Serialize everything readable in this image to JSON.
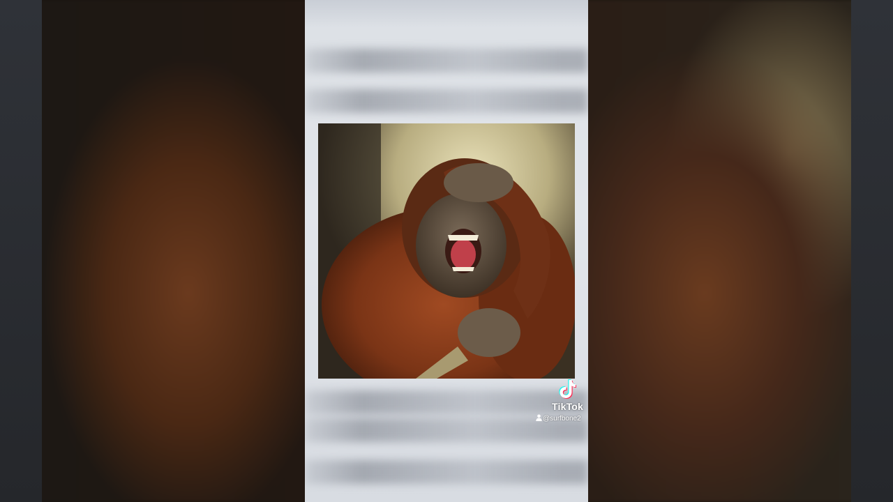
{
  "watermark": {
    "brand": "TikTok",
    "handle": "@surfbone2",
    "brand_icon": "tiktok-logo-icon",
    "user_icon": "user-icon"
  },
  "colors": {
    "watermark_text": "#ffffff",
    "frame_background": "#d9dde3"
  }
}
